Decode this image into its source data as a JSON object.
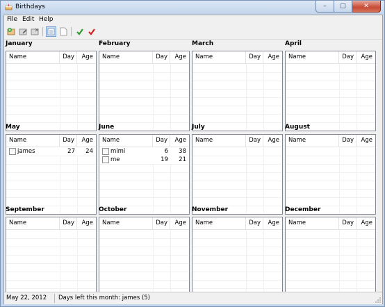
{
  "window": {
    "title": "Birthdays",
    "app_icon": "cake-icon"
  },
  "caption_buttons": {
    "minimize": "–",
    "maximize": "□",
    "close": "✕"
  },
  "menu": {
    "file": "File",
    "edit": "Edit",
    "help": "Help"
  },
  "toolbar": {
    "buttons": [
      {
        "icon": "add-person-icon"
      },
      {
        "icon": "edit-person-icon"
      },
      {
        "icon": "delete-person-icon"
      },
      {
        "icon": "list-view-icon",
        "active": true
      },
      {
        "icon": "blank-page-icon"
      },
      {
        "icon": "green-check-icon",
        "color": "#2e9b2e"
      },
      {
        "icon": "red-check-icon",
        "color": "#d32020"
      }
    ]
  },
  "columns": {
    "name": "Name",
    "day": "Day",
    "age": "Age"
  },
  "months": [
    {
      "name": "January",
      "people": []
    },
    {
      "name": "February",
      "people": []
    },
    {
      "name": "March",
      "people": []
    },
    {
      "name": "April",
      "people": []
    },
    {
      "name": "May",
      "people": [
        {
          "name": "james",
          "day": "27",
          "age": "24"
        }
      ]
    },
    {
      "name": "June",
      "people": [
        {
          "name": "mimi",
          "day": "6",
          "age": "38"
        },
        {
          "name": "me",
          "day": "19",
          "age": "21"
        }
      ]
    },
    {
      "name": "July",
      "people": []
    },
    {
      "name": "August",
      "people": []
    },
    {
      "name": "September",
      "people": []
    },
    {
      "name": "October",
      "people": []
    },
    {
      "name": "November",
      "people": []
    },
    {
      "name": "December",
      "people": []
    }
  ],
  "status": {
    "date": "May 22, 2012",
    "days_left": "Days left this month: james (5)"
  }
}
